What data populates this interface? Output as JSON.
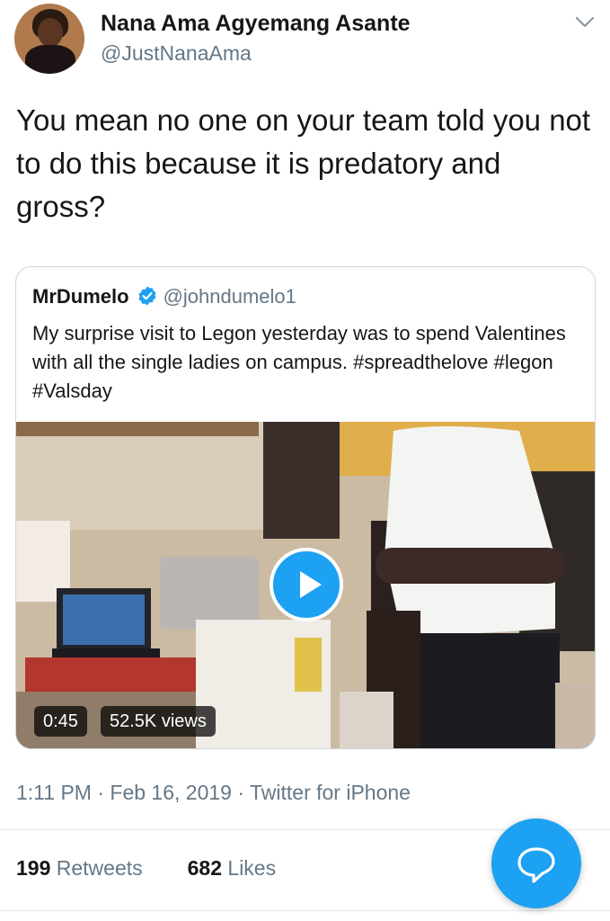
{
  "author": {
    "name": "Nana Ama Agyemang Asante",
    "handle": "@JustNanaAma"
  },
  "tweet": {
    "text": "You mean no one on your team told you not to do this because it is predatory and gross?"
  },
  "quoted": {
    "name": "MrDumelo",
    "handle": "@johndumelo1",
    "verified": true,
    "text": "My surprise visit to Legon yesterday was to spend Valentines with all the single ladies on campus. #spreadthelove #legon #Valsday",
    "video": {
      "duration": "0:45",
      "views": "52.5K views"
    }
  },
  "meta": {
    "time": "1:11 PM",
    "date": "Feb 16, 2019",
    "app": "Twitter for iPhone"
  },
  "stats": {
    "retweets_count": "199",
    "retweets_label": "Retweets",
    "likes_count": "682",
    "likes_label": "Likes"
  },
  "colors": {
    "accent": "#1da1f2",
    "secondary_text": "#657786"
  },
  "icons": {
    "more": "chevron-down-icon",
    "verified": "verified-badge-icon",
    "play": "play-icon",
    "compose": "reply-bubble-icon"
  }
}
